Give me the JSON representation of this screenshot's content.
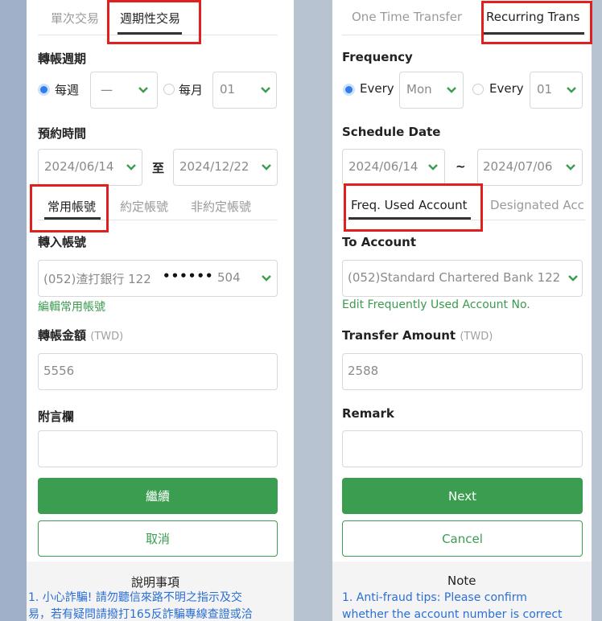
{
  "colors": {
    "accent": "#3a9d50",
    "radio": "#2f7fe8",
    "highlight": "#e0201f",
    "note": "#2b6fd6"
  },
  "zh": {
    "tabs": {
      "one_time": "單次交易",
      "recurring": "週期性交易"
    },
    "frequency_label": "轉帳週期",
    "weekly_label": "每週",
    "weekly_value": "一",
    "monthly_label": "每月",
    "monthly_value": "01",
    "schedule_label": "預約時間",
    "start_date": "2024/06/14",
    "to_word": "至",
    "end_date": "2024/12/22",
    "account_tabs": [
      "常用帳號",
      "約定帳號",
      "非約定帳號"
    ],
    "to_account_label": "轉入帳號",
    "to_account_value": "(052)渣打銀行 122",
    "to_account_mask": "••••••",
    "to_account_suffix": "504",
    "edit_link": "編輯常用帳號",
    "amount_label": "轉帳金額",
    "amount_unit": "(TWD)",
    "amount_value": "5556",
    "remark_label": "附言欄",
    "remark_value": "",
    "continue_button": "繼續",
    "cancel_button": "取消",
    "note_title": "說明事項",
    "note_lines": [
      "1. 小心詐騙! 請勿聽信來路不明之指示及交",
      "易，若有疑問請撥打165反詐騙專線查證或洽"
    ]
  },
  "en": {
    "tabs": {
      "one_time": "One Time Transfer",
      "recurring": "Recurring Trans"
    },
    "frequency_label": "Frequency",
    "weekly_label": "Every",
    "weekly_value": "Mon",
    "monthly_label": "Every",
    "monthly_value": "01",
    "schedule_label": "Schedule Date",
    "start_date": "2024/06/14",
    "to_word": "~",
    "end_date": "2024/07/06",
    "account_tabs": [
      "Freq. Used Account",
      "Designated Acc"
    ],
    "to_account_label": "To Account",
    "to_account_value": "(052)Standard Chartered Bank 122",
    "edit_link": "Edit Frequently Used Account No.",
    "amount_label": "Transfer Amount",
    "amount_unit": "(TWD)",
    "amount_value": "2588",
    "remark_label": "Remark",
    "remark_value": "",
    "next_button": "Next",
    "cancel_button": "Cancel",
    "note_title": "Note",
    "note_lines": [
      "1. Anti-fraud tips: Please confirm",
      "whether the account number is correct"
    ]
  }
}
